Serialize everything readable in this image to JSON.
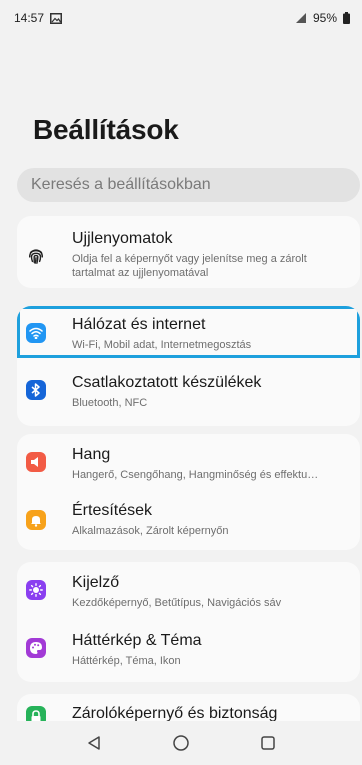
{
  "status_bar": {
    "time": "14:57",
    "battery": "95%"
  },
  "header": {
    "title": "Beállítások"
  },
  "search": {
    "placeholder": "Keresés a beállításokban"
  },
  "cards": [
    {
      "items": [
        {
          "title": "Ujjlenyomatok",
          "subtitle": "Oldja fel a képernyőt vagy jelenítse meg a zárolt tartalmat az ujjlenyomatával",
          "icon": "fingerprint-icon"
        }
      ]
    },
    {
      "items": [
        {
          "title": "Hálózat és internet",
          "subtitle": "Wi-Fi, Mobil adat, Internetmegosztás",
          "icon": "wifi-icon",
          "icon_color": "#2196f3",
          "highlighted": true
        },
        {
          "title": "Csatlakoztatott készülékek",
          "subtitle": "Bluetooth, NFC",
          "icon": "bluetooth-icon",
          "icon_color": "#1565d8"
        }
      ]
    },
    {
      "items": [
        {
          "title": "Hang",
          "subtitle": "Hangerő, Csengőhang, Hangminőség és effektu…",
          "icon": "speaker-icon",
          "icon_color": "#f25b45"
        },
        {
          "title": "Értesítések",
          "subtitle": "Alkalmazások, Zárolt képernyőn",
          "icon": "bell-icon",
          "icon_color": "#f7a21b"
        }
      ]
    },
    {
      "items": [
        {
          "title": "Kijelző",
          "subtitle": "Kezdőképernyő, Betűtípus, Navigációs sáv",
          "icon": "display-icon",
          "icon_color": "#8a3ff0"
        },
        {
          "title": "Háttérkép & Téma",
          "subtitle": "Háttérkép, Téma, Ikon",
          "icon": "palette-icon",
          "icon_color": "#a23ad6"
        }
      ]
    },
    {
      "items": [
        {
          "title": "Zárolóképernyő és biztonság",
          "icon": "lock-icon",
          "icon_color": "#27b35a"
        }
      ]
    }
  ],
  "nav_bar": {
    "back": "back-icon",
    "home": "home-icon",
    "recents": "recents-icon"
  }
}
